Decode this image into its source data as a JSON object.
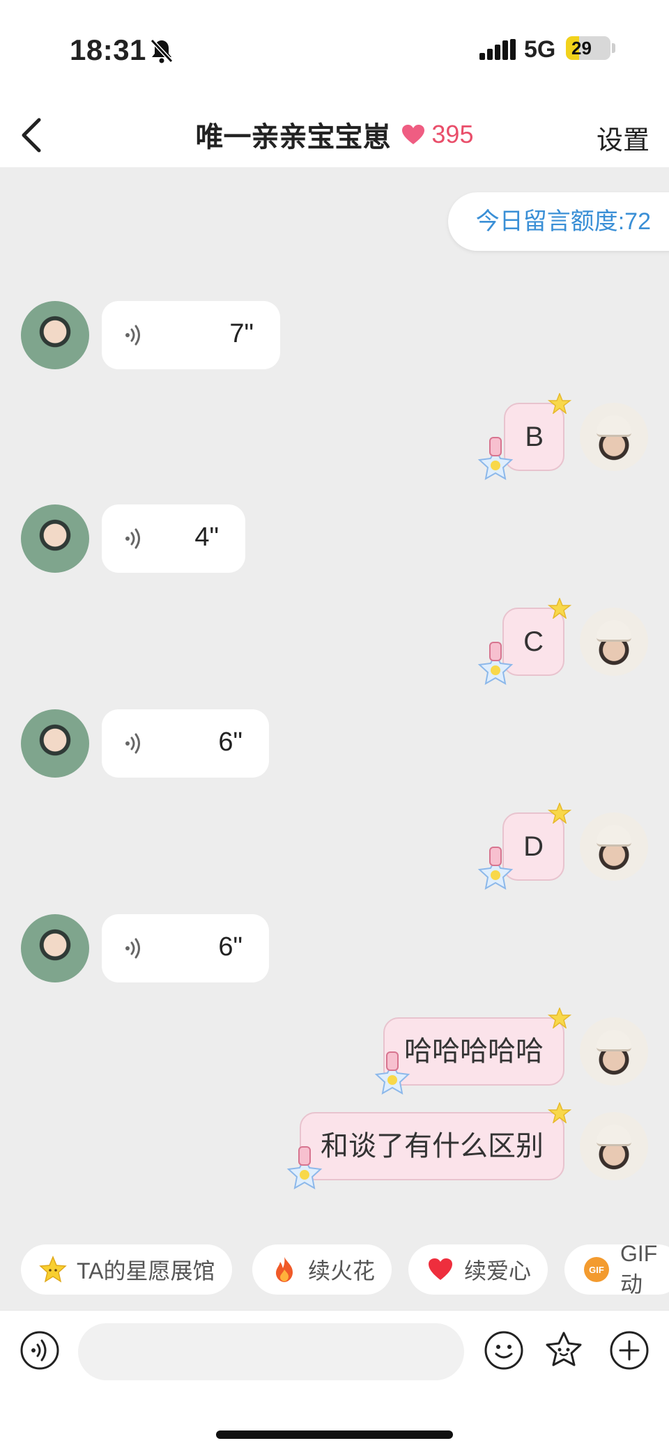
{
  "status": {
    "time": "18:31",
    "network": "5G",
    "battery": "29",
    "battery_level": 0.29
  },
  "nav": {
    "title": "唯一亲亲宝宝崽",
    "heart_count": "395",
    "settings": "设置"
  },
  "quota": "今日留言额度:72",
  "messages": [
    {
      "side": "left",
      "kind": "voice",
      "duration": "7\""
    },
    {
      "side": "right",
      "kind": "text",
      "text": "B"
    },
    {
      "side": "left",
      "kind": "voice",
      "duration": "4\""
    },
    {
      "side": "right",
      "kind": "text",
      "text": "C"
    },
    {
      "side": "left",
      "kind": "voice",
      "duration": "6\""
    },
    {
      "side": "right",
      "kind": "text",
      "text": "D"
    },
    {
      "side": "left",
      "kind": "voice",
      "duration": "6\""
    },
    {
      "side": "right",
      "kind": "text",
      "text": "哈哈哈哈哈"
    },
    {
      "side": "right",
      "kind": "text",
      "text": "和谈了有什么区别"
    }
  ],
  "chips": [
    {
      "label": "TA的星愿展馆",
      "icon": "star-icon"
    },
    {
      "label": "续火花",
      "icon": "fire-icon"
    },
    {
      "label": "续爱心",
      "icon": "heart-icon"
    },
    {
      "label": "GIF 动",
      "icon": "gif-icon"
    }
  ],
  "input": {
    "placeholder": ""
  },
  "colors": {
    "accent_pink": "#e94e6a",
    "quota_blue": "#3a8fd6",
    "bubble_pink": "#fbe3ea",
    "chat_bg": "#ededed"
  }
}
